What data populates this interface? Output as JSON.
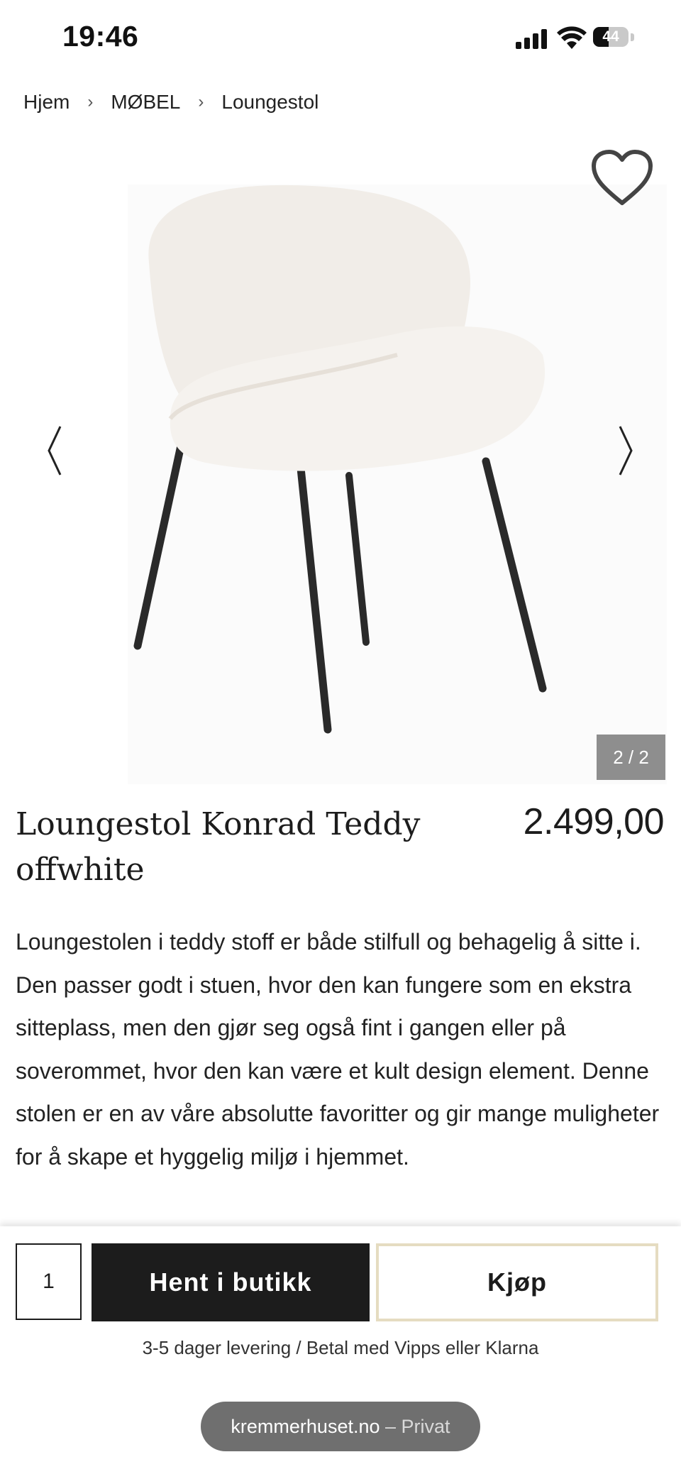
{
  "status_bar": {
    "time": "19:46",
    "battery": "44",
    "battery_level": 0.44
  },
  "breadcrumb": {
    "items": [
      "Hjem",
      "MØBEL",
      "Loungestol"
    ],
    "separator": "›"
  },
  "gallery": {
    "counter": "2 / 2",
    "image_alt": "Loungestol Konrad Teddy offwhite"
  },
  "product": {
    "title": "Loungestol Konrad Teddy offwhite",
    "price": "2.499,00",
    "description": "Loungestolen i teddy stoff er både stilfull og behagelig å sitte i. Den passer godt i stuen, hvor den kan fungere som en ekstra sitteplass, men den gjør seg også fint i gangen eller på soverommet, hvor den kan være et kult design element. Denne stolen er en av våre absolutte favoritter og gir mange muligheter for å skape et hyggelig miljø i hjemmet."
  },
  "buy_bar": {
    "quantity": "1",
    "store_button": "Hent i butikk",
    "buy_button": "Kjøp",
    "delivery_text": "3-5 dager levering / Betal med Vipps eller Klarna"
  },
  "browser": {
    "domain": "kremmerhuset.no",
    "separator": " – ",
    "mode": "Privat"
  },
  "icons": [
    "signal-icon",
    "wifi-icon",
    "battery-icon",
    "heart-icon",
    "chevron-left-icon",
    "chevron-right-icon"
  ],
  "colors": {
    "primary_button": "#1c1c1c",
    "buy_border": "#e5dcc1",
    "counter_bg": "#8e8e8e",
    "pill_bg": "#6f6f6f"
  }
}
